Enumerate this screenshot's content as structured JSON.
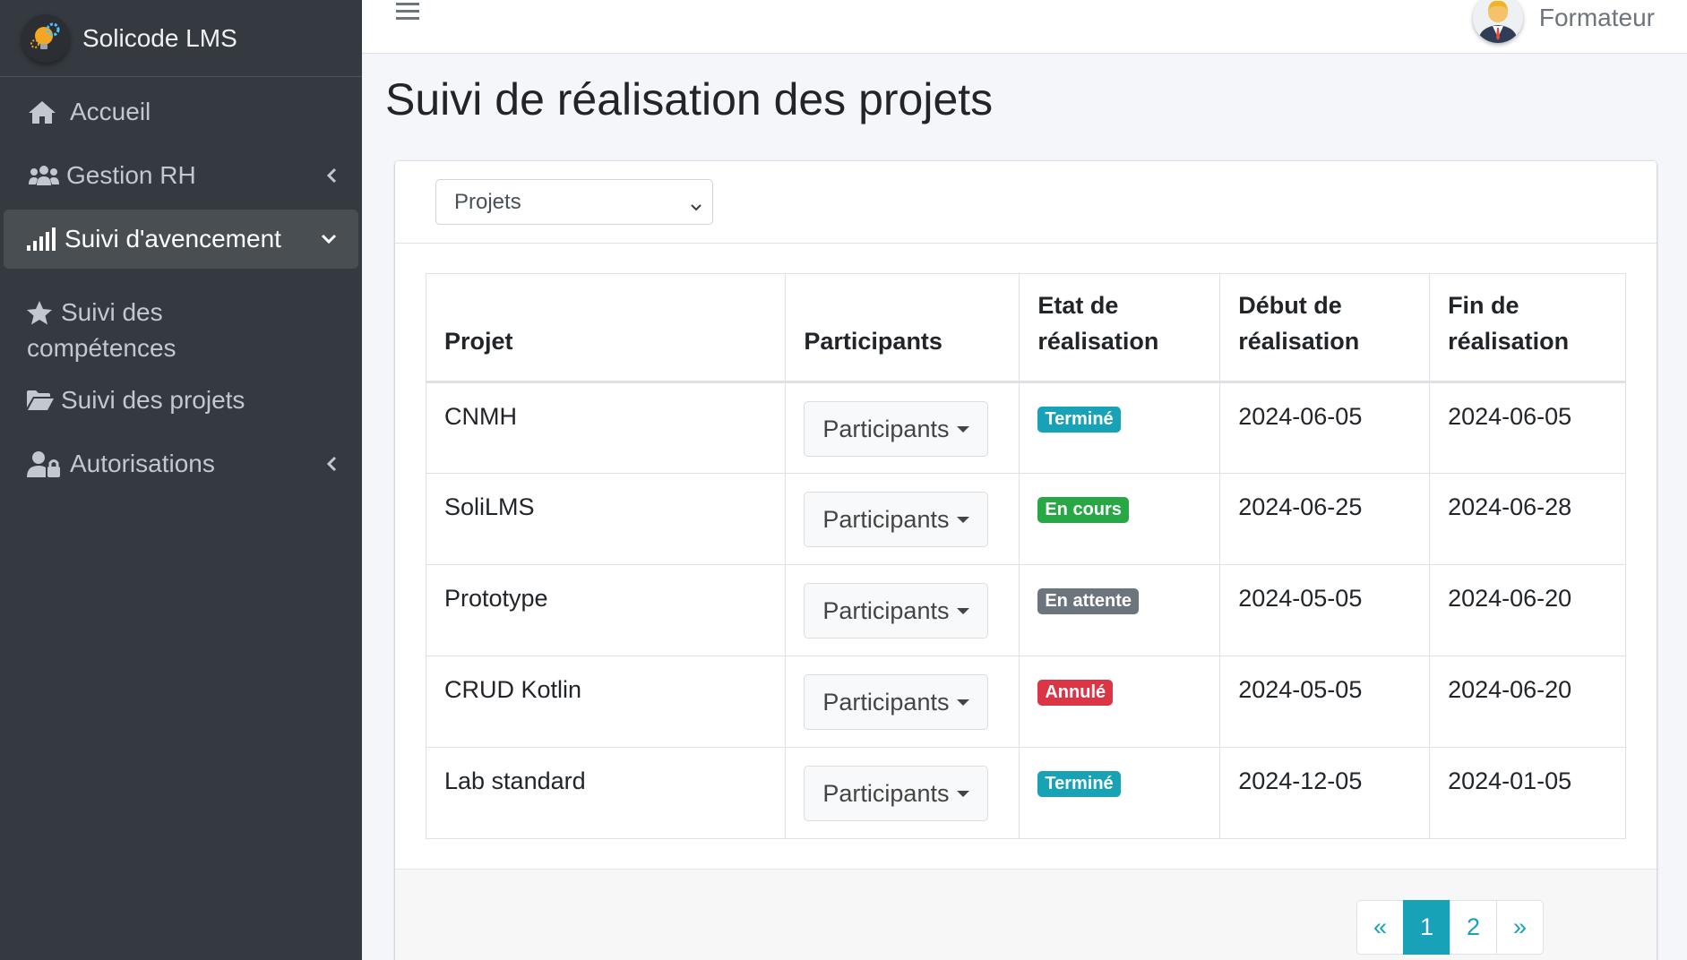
{
  "brand": {
    "name": "Solicode LMS",
    "logo_icon": "lightbulb-gear-icon"
  },
  "sidebar": {
    "items": [
      {
        "label": "Accueil",
        "icon": "home-icon",
        "active": false
      },
      {
        "label": "Gestion RH",
        "icon": "users-icon",
        "active": false,
        "chevron": "left"
      },
      {
        "label": "Suivi d'avencement",
        "icon": "signal-icon",
        "active": true,
        "chevron": "down"
      },
      {
        "label_line1": "Suivi des",
        "label_line2": "compétences",
        "icon": "star-icon",
        "active": false
      },
      {
        "label": "Suivi des projets",
        "icon": "folder-open-icon",
        "active": false
      },
      {
        "label": "Autorisations",
        "icon": "user-lock-icon",
        "active": false,
        "chevron": "left"
      }
    ]
  },
  "header": {
    "user_name": "Formateur"
  },
  "page": {
    "title": "Suivi de réalisation des projets"
  },
  "filter": {
    "selected": "Projets"
  },
  "table": {
    "headers": {
      "projet": "Projet",
      "participants": "Participants",
      "etat_l1": "Etat de",
      "etat_l2": "réalisation",
      "debut_l1": "Début de",
      "debut_l2": "réalisation",
      "fin_l1": "Fin de",
      "fin_l2": "réalisation"
    },
    "rows": [
      {
        "projet": "CNMH",
        "participants": "Participants",
        "etat": "Terminé",
        "etat_color": "#17a2b8",
        "debut": "2024-06-05",
        "fin": "2024-06-05"
      },
      {
        "projet": "SoliLMS",
        "participants": "Participants",
        "etat": "En cours",
        "etat_color": "#28a745",
        "debut": "2024-06-25",
        "fin": "2024-06-28"
      },
      {
        "projet": "Prototype",
        "participants": "Participants",
        "etat": "En attente",
        "etat_color": "#6c757d",
        "debut": "2024-05-05",
        "fin": "2024-06-20"
      },
      {
        "projet": "CRUD Kotlin",
        "participants": "Participants",
        "etat": "Annulé",
        "etat_color": "#dc3545",
        "debut": "2024-05-05",
        "fin": "2024-06-20"
      },
      {
        "projet": "Lab standard",
        "participants": "Participants",
        "etat": "Terminé",
        "etat_color": "#17a2b8",
        "debut": "2024-12-05",
        "fin": "2024-01-05"
      }
    ]
  },
  "pagination": {
    "prev": "«",
    "pages": [
      "1",
      "2"
    ],
    "current": "1",
    "next": "»"
  }
}
